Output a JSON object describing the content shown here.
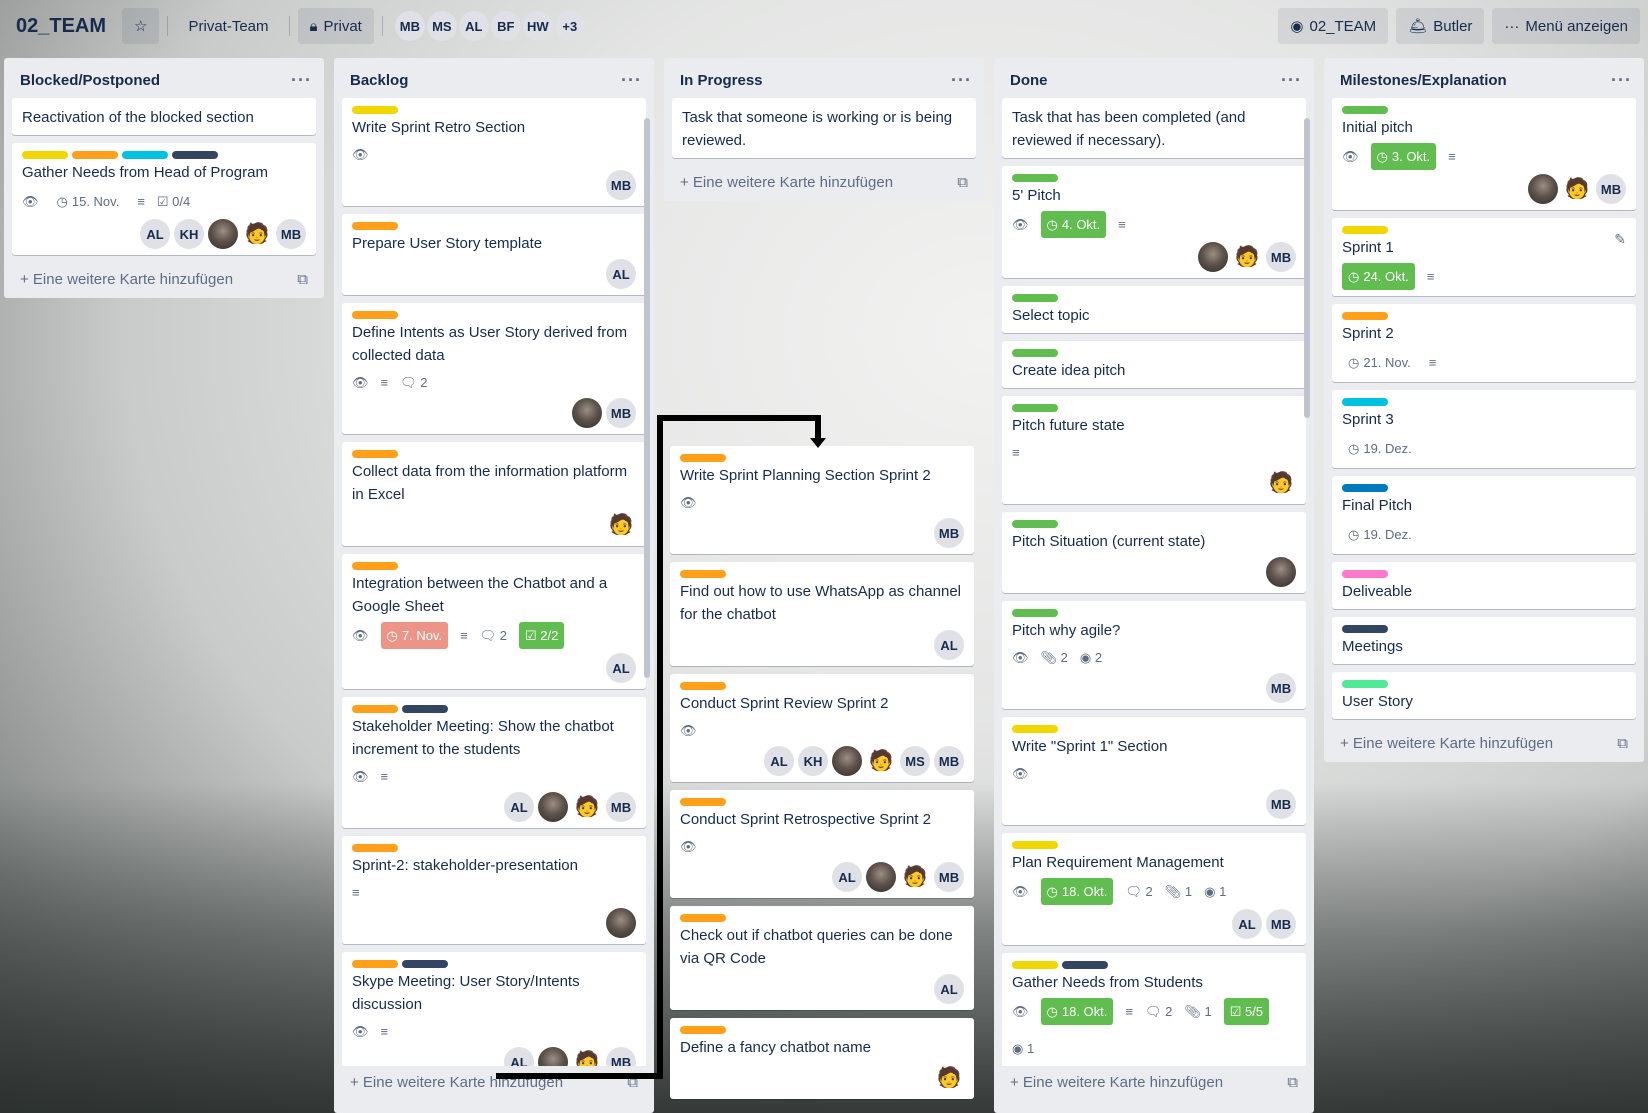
{
  "board": {
    "title": "02_TEAM",
    "team": "Privat-Team",
    "visibility": "Privat",
    "members": [
      "MB",
      "MS",
      "AL",
      "BF",
      "HW"
    ],
    "more_members": "+3",
    "github_label": "02_TEAM",
    "butler_label": "Butler",
    "menu_label": "Menü anzeigen"
  },
  "add_card_label": "Eine weitere Karte hinzufügen",
  "colors": {
    "green": "#61bd4f",
    "yellow": "#f2d600",
    "orange": "#ff9f1a",
    "sky": "#00c2e0",
    "black": "#344563",
    "blue": "#0079bf",
    "pink": "#ff78cb",
    "lime": "#51e898",
    "red": "#eb5a46"
  },
  "lists": [
    {
      "title": "Blocked/Postponed",
      "cards": [
        {
          "title": "Reactivation of the blocked section",
          "labels": [],
          "badges": {},
          "members": []
        },
        {
          "title": "Gather Needs from Head of Program",
          "labels": [
            "yellow",
            "orange",
            "sky",
            "black"
          ],
          "badges": {
            "watch": true,
            "due": "15. Nov.",
            "due_style": "plain",
            "checklist": "0/4",
            "description": true
          },
          "members": [
            "AL",
            "KH",
            "photo",
            "emoji",
            "MB"
          ]
        }
      ]
    },
    {
      "title": "Backlog",
      "cards": [
        {
          "title": "Write Sprint Retro Section",
          "labels": [
            "yellow"
          ],
          "badges": {
            "watch": true
          },
          "members": [
            "MB"
          ]
        },
        {
          "title": "Prepare User Story template",
          "labels": [
            "orange"
          ],
          "badges": {},
          "members": [
            "AL"
          ]
        },
        {
          "title": "Define Intents as User Story derived from collected data",
          "labels": [
            "orange"
          ],
          "badges": {
            "watch": true,
            "description": true,
            "comments": "2"
          },
          "members": [
            "photo",
            "MB"
          ]
        },
        {
          "title": "Collect data from the information platform in Excel",
          "labels": [
            "orange"
          ],
          "badges": {},
          "members": [
            "emoji"
          ]
        },
        {
          "title": "Integration between the Chatbot and a Google Sheet",
          "labels": [
            "orange"
          ],
          "badges": {
            "watch": true,
            "due": "7. Nov.",
            "due_style": "red",
            "description": true,
            "comments": "2",
            "checklist": "2/2",
            "checklist_style": "green"
          },
          "members": [
            "AL"
          ]
        },
        {
          "title": "Stakeholder Meeting: Show the chatbot increment to the students",
          "labels": [
            "orange",
            "black"
          ],
          "badges": {
            "watch": true,
            "description": true
          },
          "members": [
            "AL",
            "photo",
            "emoji",
            "MB"
          ]
        },
        {
          "title": "Sprint-2: stakeholder-presentation",
          "labels": [
            "orange"
          ],
          "badges": {
            "description": true
          },
          "members": [
            "photo"
          ]
        },
        {
          "title": "Skype Meeting: User Story/Intents discussion",
          "labels": [
            "orange",
            "black"
          ],
          "badges": {
            "watch": true,
            "description": true
          },
          "members": [
            "AL",
            "photo",
            "emoji",
            "MB"
          ]
        }
      ]
    },
    {
      "title": "In Progress",
      "cards": [
        {
          "title": "Task that someone is working or is being reviewed.",
          "labels": [],
          "badges": {},
          "members": []
        }
      ],
      "dragged_cards": [
        {
          "title": "Write Sprint Planning Section Sprint 2",
          "labels": [
            "orange"
          ],
          "badges": {
            "watch": true
          },
          "members": [
            "MB"
          ]
        },
        {
          "title": "Find out how to use WhatsApp as channel for the chatbot",
          "labels": [
            "orange"
          ],
          "badges": {},
          "members": [
            "AL"
          ]
        },
        {
          "title": "Conduct Sprint Review Sprint 2",
          "labels": [
            "orange"
          ],
          "badges": {
            "watch": true
          },
          "members": [
            "AL",
            "KH",
            "photo",
            "emoji",
            "MS",
            "MB"
          ]
        },
        {
          "title": "Conduct Sprint Retrospective Sprint 2",
          "labels": [
            "orange"
          ],
          "badges": {
            "watch": true
          },
          "members": [
            "AL",
            "photo",
            "emoji",
            "MB"
          ]
        },
        {
          "title": "Check out if chatbot queries can be done via QR Code",
          "labels": [
            "orange"
          ],
          "badges": {},
          "members": [
            "AL"
          ]
        },
        {
          "title": "Define a fancy chatbot name",
          "labels": [
            "orange"
          ],
          "badges": {},
          "members": [
            "emoji"
          ]
        }
      ]
    },
    {
      "title": "Done",
      "cards": [
        {
          "title": "Task that has been completed (and reviewed if necessary).",
          "labels": [],
          "badges": {},
          "members": []
        },
        {
          "title": "5' Pitch",
          "labels": [
            "green"
          ],
          "badges": {
            "watch": true,
            "due": "4. Okt.",
            "due_style": "green",
            "description": true
          },
          "members": [
            "photo",
            "emoji",
            "MB"
          ]
        },
        {
          "title": "Select topic",
          "labels": [
            "green"
          ],
          "badges": {},
          "members": []
        },
        {
          "title": "Create idea pitch",
          "labels": [
            "green"
          ],
          "badges": {},
          "members": []
        },
        {
          "title": "Pitch future state",
          "labels": [
            "green"
          ],
          "badges": {
            "description": true
          },
          "members": [
            "emoji"
          ]
        },
        {
          "title": "Pitch Situation (current state)",
          "labels": [
            "green"
          ],
          "badges": {},
          "members": [
            "photo"
          ]
        },
        {
          "title": "Pitch why agile?",
          "labels": [
            "green"
          ],
          "badges": {
            "watch": true,
            "attachments": "2",
            "github": "2"
          },
          "members": [
            "MB"
          ]
        },
        {
          "title": "Write \"Sprint 1\" Section",
          "labels": [
            "yellow"
          ],
          "badges": {
            "watch": true
          },
          "members": [
            "MB"
          ]
        },
        {
          "title": "Plan Requirement Management",
          "labels": [
            "yellow"
          ],
          "badges": {
            "watch": true,
            "due": "18. Okt.",
            "due_style": "green",
            "comments": "2",
            "attachments": "1",
            "github": "1"
          },
          "members": [
            "AL",
            "MB"
          ]
        },
        {
          "title": "Gather Needs from Students",
          "labels": [
            "yellow",
            "black"
          ],
          "badges": {
            "watch": true,
            "due": "18. Okt.",
            "due_style": "green",
            "description": true,
            "comments": "2",
            "attachments": "1",
            "checklist": "5/5",
            "checklist_style": "green",
            "github": "1"
          },
          "members": [
            "emoji"
          ]
        }
      ]
    },
    {
      "title": "Milestones/Explanation",
      "cards": [
        {
          "title": "Initial pitch",
          "labels": [
            "green"
          ],
          "badges": {
            "watch": true,
            "due": "3. Okt.",
            "due_style": "green",
            "description": true
          },
          "members": [
            "photo",
            "emoji",
            "MB"
          ]
        },
        {
          "title": "Sprint 1",
          "labels": [
            "yellow"
          ],
          "badges": {
            "due": "24. Okt.",
            "due_style": "green",
            "description": true
          },
          "members": []
        },
        {
          "title": "Sprint 2",
          "labels": [
            "orange"
          ],
          "badges": {
            "due": "21. Nov.",
            "due_style": "plain",
            "description": true
          },
          "members": []
        },
        {
          "title": "Sprint 3",
          "labels": [
            "sky"
          ],
          "badges": {
            "due": "19. Dez.",
            "due_style": "plain"
          },
          "members": []
        },
        {
          "title": "Final Pitch",
          "labels": [
            "blue"
          ],
          "badges": {
            "due": "19. Dez.",
            "due_style": "plain"
          },
          "members": []
        },
        {
          "title": "Deliveable",
          "labels": [
            "pink"
          ],
          "badges": {},
          "members": []
        },
        {
          "title": "Meetings",
          "labels": [
            "black"
          ],
          "badges": {},
          "members": []
        },
        {
          "title": "User Story",
          "labels": [
            "lime"
          ],
          "badges": {},
          "members": []
        }
      ]
    }
  ]
}
